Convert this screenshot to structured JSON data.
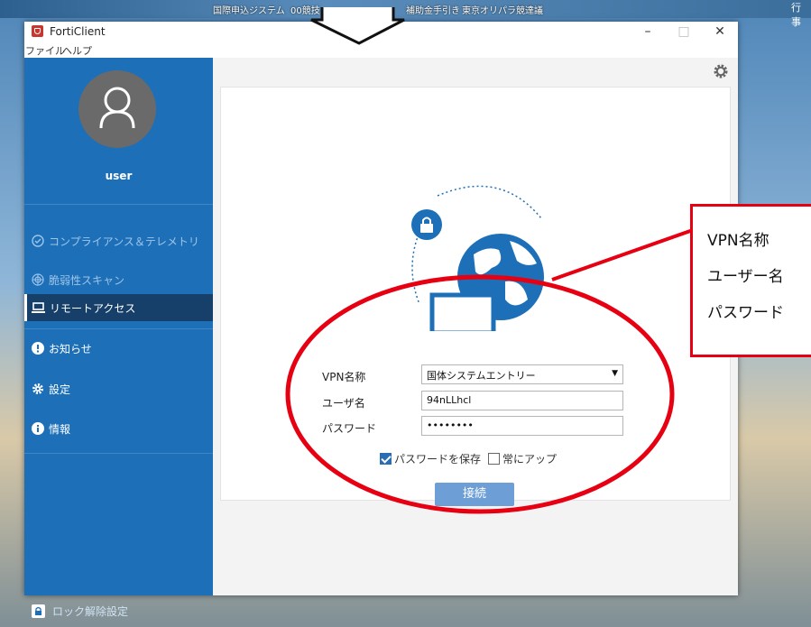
{
  "desktop": {
    "taskbar_texts": [
      "国際申込ジステム",
      "00競技",
      "補助金手引き",
      "東京オリパラ競達議"
    ],
    "right_text": "行事"
  },
  "window": {
    "title": "FortiClient",
    "controls": {
      "minimize": "–",
      "maximize": "□",
      "close": "✕"
    },
    "menu": [
      "ファイル",
      "ヘルプ"
    ]
  },
  "sidebar": {
    "user": "user",
    "items": [
      {
        "label": "コンプライアンス＆テレメトリ",
        "icon": "compliance-icon",
        "state": "dim"
      },
      {
        "label": "脆弱性スキャン",
        "icon": "scan-icon",
        "state": "dim"
      },
      {
        "label": "リモートアクセス",
        "icon": "laptop-icon",
        "state": "active"
      },
      {
        "label": "お知らせ",
        "icon": "notice-icon",
        "state": "normal"
      },
      {
        "label": "設定",
        "icon": "gear-icon",
        "state": "normal"
      },
      {
        "label": "情報",
        "icon": "info-icon",
        "state": "normal"
      }
    ],
    "lock_label": "ロック解除設定"
  },
  "form": {
    "vpn_label": "VPN名称",
    "vpn_value": "国体システムエントリー",
    "user_label": "ユーザ名",
    "user_value": "94nLLhcl",
    "pass_label": "パスワード",
    "pass_value": "••••••••",
    "save_password_label": "パスワードを保存",
    "save_password_checked": true,
    "always_up_label": "常にアップ",
    "always_up_checked": false,
    "connect_label": "接続"
  },
  "callout": {
    "lines": [
      "VPN名称",
      "ユーザー名",
      "パスワード"
    ]
  },
  "colors": {
    "sidebar": "#1d6fb8",
    "sidebar_active": "#163f6a",
    "connect_button": "#6d9fd6",
    "annotation_red": "#e60012"
  }
}
